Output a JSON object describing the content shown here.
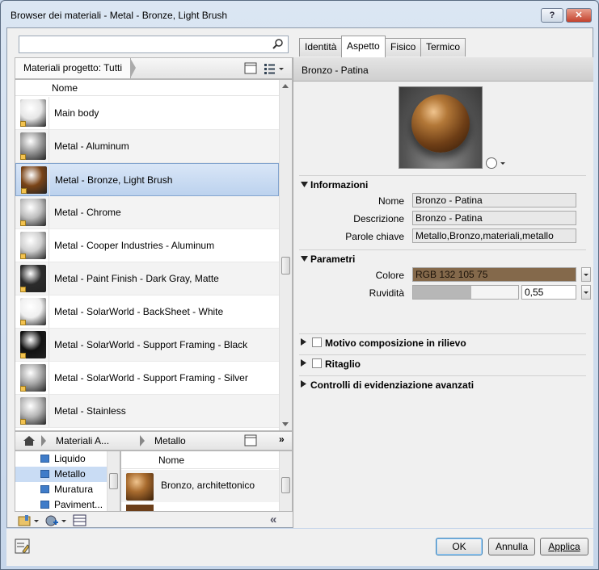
{
  "window": {
    "title": "Browser dei materiali - Metal - Bronze, Light Brush",
    "help_label": "?",
    "close_label": "✕"
  },
  "left": {
    "search": {
      "placeholder": "",
      "value": ""
    },
    "filter_label": "Materiali progetto: Tutti",
    "column_header": "Nome",
    "materials": [
      {
        "label": "Main body",
        "swatch": "#e6e6e6"
      },
      {
        "label": "Metal - Aluminum",
        "swatch": "#9a9a9a"
      },
      {
        "label": "Metal - Bronze, Light Brush",
        "swatch": "#7a4417"
      },
      {
        "label": "Metal - Chrome",
        "swatch": "#bdbdbd"
      },
      {
        "label": "Metal - Cooper Industries - Aluminum",
        "swatch": "#cfcfcf"
      },
      {
        "label": "Metal - Paint Finish - Dark Gray, Matte",
        "swatch": "#2b2b2b"
      },
      {
        "label": "Metal - SolarWorld - BackSheet - White",
        "swatch": "#efefef"
      },
      {
        "label": "Metal - SolarWorld - Support Framing - Black",
        "swatch": "#111111"
      },
      {
        "label": "Metal - SolarWorld - Support Framing - Silver",
        "swatch": "#a8a8a8"
      },
      {
        "label": "Metal - Stainless",
        "swatch": "#b4b4b4"
      }
    ],
    "nav": {
      "seg1": "Materiali A...",
      "seg2": "Metallo",
      "more": "»"
    },
    "tree": [
      "Liquido",
      "Metallo",
      "Muratura",
      "Paviment..."
    ],
    "library": {
      "header": "Nome",
      "items": [
        {
          "label": "Bronzo, architettonico"
        }
      ]
    },
    "collapse_label": "«"
  },
  "right": {
    "tabs": [
      "Identità",
      "Aspetto",
      "Fisico",
      "Termico"
    ],
    "active_tab": "Aspetto",
    "header": "Bronzo - Patina",
    "sections": {
      "info": "Informazioni",
      "params": "Parametri",
      "relief": "Motivo composizione in rilievo",
      "cutout": "Ritaglio",
      "advanced": "Controlli di evidenziazione avanzati"
    },
    "info": {
      "name_label": "Nome",
      "name_value": "Bronzo - Patina",
      "desc_label": "Descrizione",
      "desc_value": "Bronzo - Patina",
      "kw_label": "Parole chiave",
      "kw_value": "Metallo,Bronzo,materiali,metallo"
    },
    "params": {
      "color_label": "Colore",
      "color_value": "RGB 132 105 75",
      "color_hex": "#84694b",
      "rough_label": "Ruvidità",
      "rough_value": "0,55",
      "rough_fraction": 0.55
    }
  },
  "buttons": {
    "ok": "OK",
    "cancel": "Annulla",
    "apply": "Applica"
  }
}
